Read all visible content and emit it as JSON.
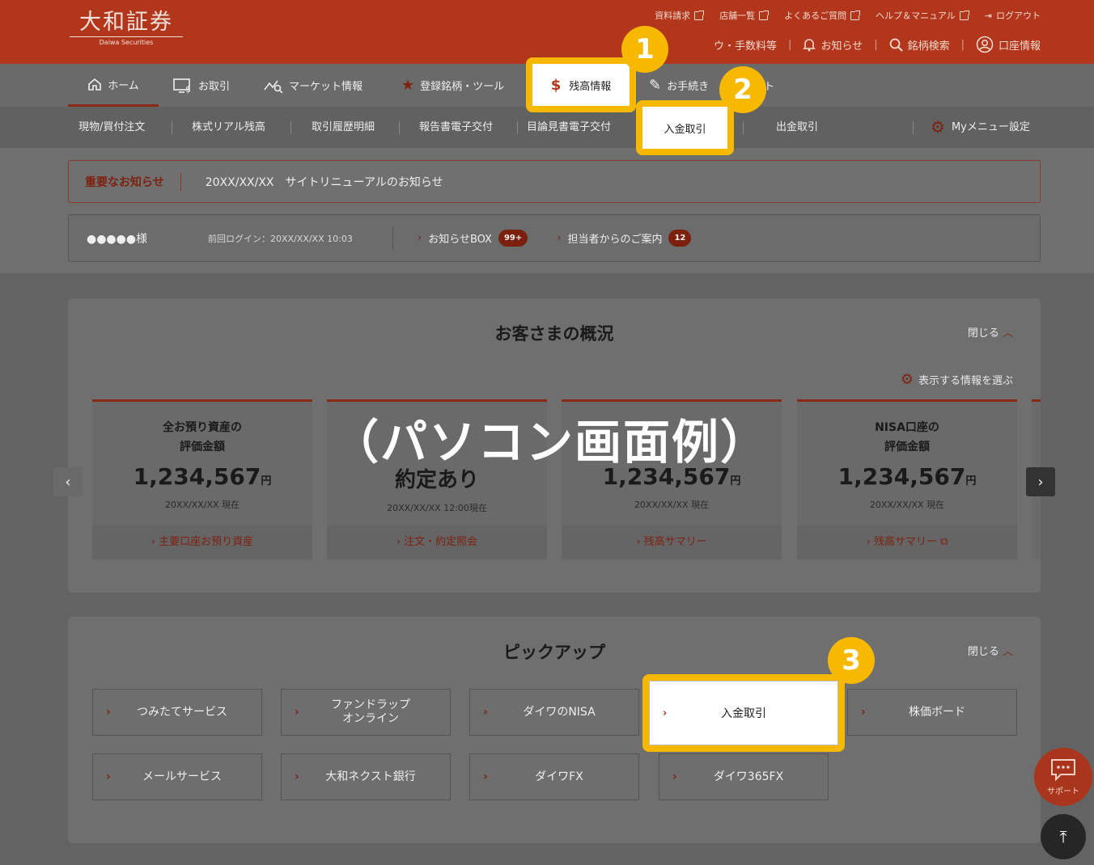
{
  "logo": {
    "jp": "大和証券",
    "en": "Daiwa Securities"
  },
  "util_links": [
    "資料請求",
    "店舗一覧",
    "よくあるご質問",
    "ヘルプ＆マニュアル",
    "ログアウト"
  ],
  "util2": {
    "fees": "ウ・手数料等",
    "notice": "お知らせ",
    "search": "銘柄検索",
    "account": "口座情報"
  },
  "nav": {
    "home": "ホーム",
    "trade": "お取引",
    "market": "マーケット情報",
    "favorites": "登録銘柄・ツール",
    "balance": "残高情報",
    "procedures": "お手続き",
    "more": "ト"
  },
  "subnav": [
    "現物/買付注文",
    "株式リアル残高",
    "取引履歴明細",
    "報告書電子交付",
    "目論見書電子交付",
    "入金取引",
    "出金取引",
    "Myメニュー設定"
  ],
  "notice": {
    "label": "重要なお知らせ",
    "text": "20XX/XX/XX　サイトリニューアルのお知らせ"
  },
  "user": {
    "name": "●●●●●様",
    "last_login": "前回ログイン：20XX/XX/XX 10:03",
    "box_label": "お知らせBOX",
    "box_count": "99+",
    "rep_label": "担当者からのご案内",
    "rep_count": "12"
  },
  "overview": {
    "title": "お客さまの概況",
    "close": "閉じる",
    "select_info": "表示する情報を選ぶ"
  },
  "cards": [
    {
      "title1": "全お預り資産の",
      "title2": "評価金額",
      "value": "1,234,567",
      "unit": "円",
      "date": "20XX/XX/XX 現在",
      "link": "主要口座お預り資産"
    },
    {
      "title1": "",
      "title2": "",
      "value": "約定あり",
      "unit": "",
      "date": "20XX/XX/XX 12:00現在",
      "link": "注文・約定照会"
    },
    {
      "title1": "",
      "title2": "",
      "value": "1,234,567",
      "unit": "円",
      "date": "20XX/XX/XX 現在",
      "link": "残高サマリー"
    },
    {
      "title1": "NISA口座の",
      "title2": "評価金額",
      "value": "1,234,567",
      "unit": "円",
      "date": "20XX/XX/XX 現在",
      "link": "残高サマリー"
    }
  ],
  "pc_label": "（パソコン画面例）",
  "pickup": {
    "title": "ピックアップ",
    "close": "閉じる",
    "tiles": [
      "つみたてサービス",
      "ファンドラップ\nオンライン",
      "ダイワのNISA",
      "入金取引",
      "株価ボード",
      "メールサービス",
      "大和ネクスト銀行",
      "ダイワFX",
      "ダイワ365FX"
    ]
  },
  "steps": [
    "1",
    "2",
    "3"
  ],
  "support": "サポート",
  "colors": {
    "brand": "#b2361b",
    "highlight": "#f7b900"
  }
}
